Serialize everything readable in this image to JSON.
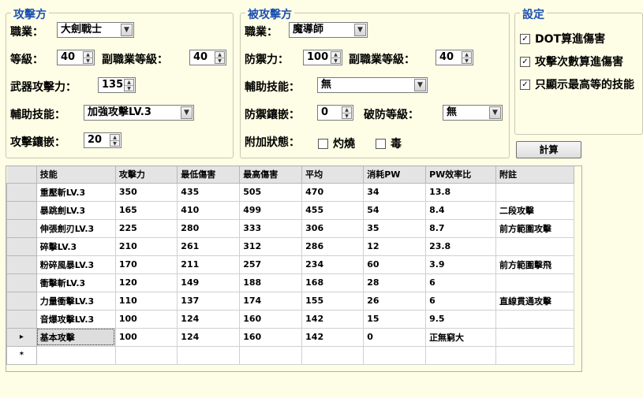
{
  "attacker": {
    "title": "攻擊方",
    "job_label": "職業：",
    "job_value": "大劍戰士",
    "level_label": "等級：",
    "level_value": "40",
    "sublevel_label": "副職業等級：",
    "sublevel_value": "40",
    "weapon_label": "武器攻擊力：",
    "weapon_value": "135",
    "aux_label": "輔助技能：",
    "aux_value": "加強攻擊LV.3",
    "inlay_label": "攻擊鑲嵌：",
    "inlay_value": "20"
  },
  "defender": {
    "title": "被攻擊方",
    "job_label": "職業：",
    "job_value": "魔導師",
    "def_label": "防禦力：",
    "def_value": "100",
    "sublevel_label": "副職業等級：",
    "sublevel_value": "40",
    "aux_label": "輔助技能：",
    "aux_value": "無",
    "inlay_label": "防禦鑲嵌：",
    "inlay_value": "0",
    "break_label": "破防等級：",
    "break_value": "無",
    "status_label": "附加狀態：",
    "burn_label": "灼燒",
    "poison_label": "毒"
  },
  "settings": {
    "title": "設定",
    "opt1": "DOT算進傷害",
    "opt2": "攻擊次數算進傷害",
    "opt3": "只顯示最高等的技能"
  },
  "calc_label": "計算",
  "table": {
    "headers": [
      "技能",
      "攻擊力",
      "最低傷害",
      "最高傷害",
      "平均",
      "消耗PW",
      "PW效率比",
      "附註"
    ],
    "rows": [
      [
        "重壓斬LV.3",
        "350",
        "435",
        "505",
        "470",
        "34",
        "13.8",
        ""
      ],
      [
        "暴跳劍LV.3",
        "165",
        "410",
        "499",
        "455",
        "54",
        "8.4",
        "二段攻擊"
      ],
      [
        "伸張劍刃LV.3",
        "225",
        "280",
        "333",
        "306",
        "35",
        "8.7",
        "前方範圍攻擊"
      ],
      [
        "碎擊LV.3",
        "210",
        "261",
        "312",
        "286",
        "12",
        "23.8",
        ""
      ],
      [
        "粉碎風暴LV.3",
        "170",
        "211",
        "257",
        "234",
        "60",
        "3.9",
        "前方範圍擊飛"
      ],
      [
        "衝擊斬LV.3",
        "120",
        "149",
        "188",
        "168",
        "28",
        "6",
        ""
      ],
      [
        "力量衝擊LV.3",
        "110",
        "137",
        "174",
        "155",
        "26",
        "6",
        "直線貫通攻擊"
      ],
      [
        "音爆攻擊LV.3",
        "100",
        "124",
        "160",
        "142",
        "15",
        "9.5",
        ""
      ],
      [
        "基本攻擊",
        "100",
        "124",
        "160",
        "142",
        "0",
        "正無窮大",
        ""
      ]
    ],
    "current_row_marker": "▸",
    "new_row_marker": "*"
  }
}
